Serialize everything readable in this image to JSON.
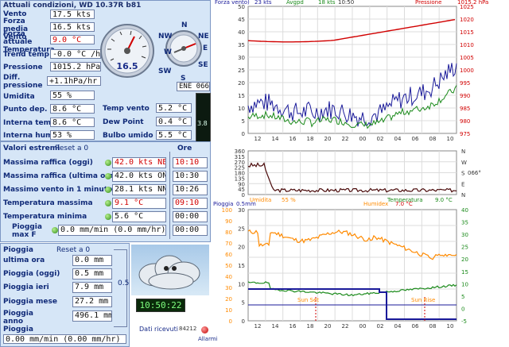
{
  "title": "Attuali condizioni, WD 10.37R b81",
  "current": [
    {
      "label": "Vento",
      "value": "17.5 kts"
    },
    {
      "label": "Forza media Vento",
      "value": "16.5 kts"
    },
    {
      "label": "Forza attuale Temperatura",
      "value": "9.0 °C"
    },
    {
      "label": "Trend temp",
      "value": "-0.0 °C /hr"
    },
    {
      "label": "Pressione",
      "value": "1015.2 hPa"
    },
    {
      "label": "Diff. pressione",
      "value": "+1.1hPa/hr"
    },
    {
      "label": "Umidita",
      "value": "55 %"
    },
    {
      "label": "Punto dep.",
      "value": "8.6 °C"
    },
    {
      "label": "Interna temp.",
      "value": "8.6 °C"
    },
    {
      "label": "Interna hum",
      "value": "53 %"
    }
  ],
  "gauge": {
    "value": "16.5",
    "ticks": [
      "0",
      "10",
      "20",
      "30",
      "40",
      "45",
      "50"
    ]
  },
  "compass": {
    "n": "N",
    "ne": "NE",
    "e": "E",
    "se": "SE",
    "s": "S",
    "sw": "SW",
    "w": "W",
    "nw": "NW",
    "direction": "ENE 066 °"
  },
  "extra": [
    {
      "label": "Temp vento",
      "value": "5.2 °C"
    },
    {
      "label": "Dew Point",
      "value": "0.4 °C"
    },
    {
      "label": "Bulbo umido",
      "value": "5.5 °C"
    }
  ],
  "uv_value": "3.8",
  "extremes": {
    "title": "Valori estremi",
    "reset": "Reset a 0",
    "ore_label": "Ore",
    "rows": [
      {
        "label": "Massima raffica (oggi)",
        "value": "42.0 kts  NE",
        "time": "10:10",
        "red": true
      },
      {
        "label": "Massima raffica (ultima ora)",
        "value": "42.0 kts ONO",
        "time": "10:30",
        "red": false
      },
      {
        "label": "Massimo vento in 1 minuto",
        "value": "28.1 kts NNE",
        "time": "10:26",
        "red": false
      },
      {
        "label": "Temperatura massima",
        "value": "9.1 °C",
        "time": "09:10",
        "red": true
      },
      {
        "label": "Temperatura minima",
        "value": "5.6 °C",
        "time": "00:00",
        "red": false
      },
      {
        "label": "Pioggia max F",
        "value": "0.0 mm/min (0.0 mm/hr)",
        "time": "00:00",
        "red": false
      }
    ]
  },
  "rain": {
    "title": "Pioggia",
    "reset": "Reset a 0",
    "rows": [
      {
        "label": "ultima ora",
        "value": "0.0 mm"
      },
      {
        "label": "Pioggia (oggi)",
        "value": "0.5 mm"
      },
      {
        "label": "Pioggia ieri",
        "value": "7.9 mm"
      },
      {
        "label": "Pioggia mese",
        "value": "27.2 mm"
      },
      {
        "label": "Pioggia anno Pioggia",
        "value": "496.1 mm"
      }
    ],
    "rate": "0.00 mm/min (0.00 mm/hr)",
    "bracket_value": "0.5"
  },
  "clock": "10:50:22",
  "dati_label": "Dati ricevuti",
  "dati_count": "84212",
  "allarme_label": "Allarmi",
  "chart_top": {
    "legend": [
      "Forza vento)",
      "23 kts",
      "Avgpd",
      "18 kts",
      "10:50",
      "Pressione",
      "1015.2 hPa"
    ],
    "y_left": [
      "50",
      "45",
      "40",
      "35",
      "30",
      "25",
      "20",
      "15",
      "10",
      "5",
      "0"
    ],
    "y_right": [
      "1025",
      "1020",
      "1015",
      "1010",
      "1005",
      "1000",
      "995",
      "990",
      "985",
      "980",
      "975"
    ],
    "x": [
      "12",
      "14",
      "16",
      "18",
      "20",
      "22",
      "00",
      "02",
      "04",
      "06",
      "08",
      "10"
    ]
  },
  "chart_mid": {
    "y_left": [
      "360",
      "315",
      "270",
      "225",
      "180",
      "135",
      "90",
      "45",
      "0"
    ],
    "y_right": [
      "N",
      "W",
      "S",
      "E",
      "N"
    ],
    "right_label": "066°",
    "legend": [
      "Umidita",
      "55 %",
      "Temperatura",
      "9.0 °C"
    ]
  },
  "chart_bot": {
    "legend": [
      "Pioggia",
      "0.5mm",
      "Humidex",
      "7.0 °C"
    ],
    "y_left": [
      "30",
      "25",
      "20",
      "15",
      "10",
      "5",
      "0"
    ],
    "y_right": [
      "40",
      "35",
      "30",
      "25",
      "20",
      "15",
      "10",
      "5",
      "0",
      "-5"
    ],
    "y_left2": [
      "100",
      "90",
      "80",
      "70",
      "60",
      "50",
      "40",
      "30",
      "20",
      "10",
      "0"
    ],
    "x": [
      "12",
      "14",
      "16",
      "18",
      "20",
      "22",
      "00",
      "02",
      "04",
      "06",
      "08",
      "10"
    ],
    "sunset": "Sun Set",
    "sunrise": "Sun Rise"
  },
  "colors": {
    "panel": "#d6e6f7",
    "wind": "#1a1a9a",
    "avg": "#1a8a1a",
    "pressure": "#d10000",
    "humidity": "#ff8a00",
    "dir": "#4a0a0a"
  }
}
